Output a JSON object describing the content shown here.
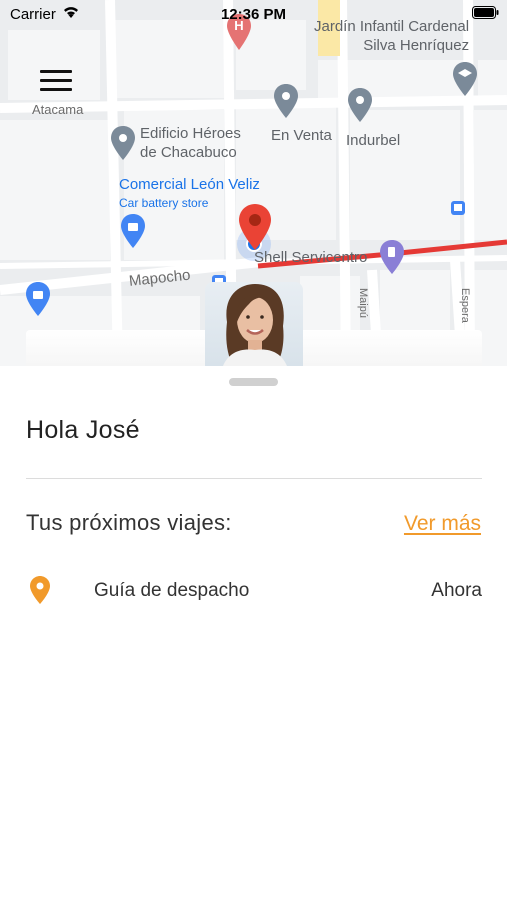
{
  "status_bar": {
    "carrier": "Carrier",
    "time": "12:36 PM"
  },
  "map": {
    "labels": {
      "school": "Jardín Infantil Cardenal\nSilva Henríquez",
      "atacama": "Atacama",
      "edificio": "Edificio Héroes\nde Chacabuco",
      "en_venta": "En Venta",
      "indurbel": "Indurbel",
      "comercial": "Comercial León Veliz",
      "car_battery": "Car battery store",
      "mapocho": "Mapocho",
      "shell": "Shell Servicentro",
      "maipu": "Maipú",
      "espera": "Espera"
    },
    "colors": {
      "route": "#e53935",
      "pin_red": "#ea4335",
      "poi_gray": "#7b8a99",
      "poi_blue": "#4285f4"
    }
  },
  "sheet": {
    "greeting": "Hola José",
    "trips_heading": "Tus próximos viajes:",
    "see_more": "Ver más",
    "trips": [
      {
        "name": "Guía de despacho",
        "time": "Ahora",
        "icon": "location-pin-icon"
      }
    ],
    "accent_color": "#f19a2b"
  }
}
